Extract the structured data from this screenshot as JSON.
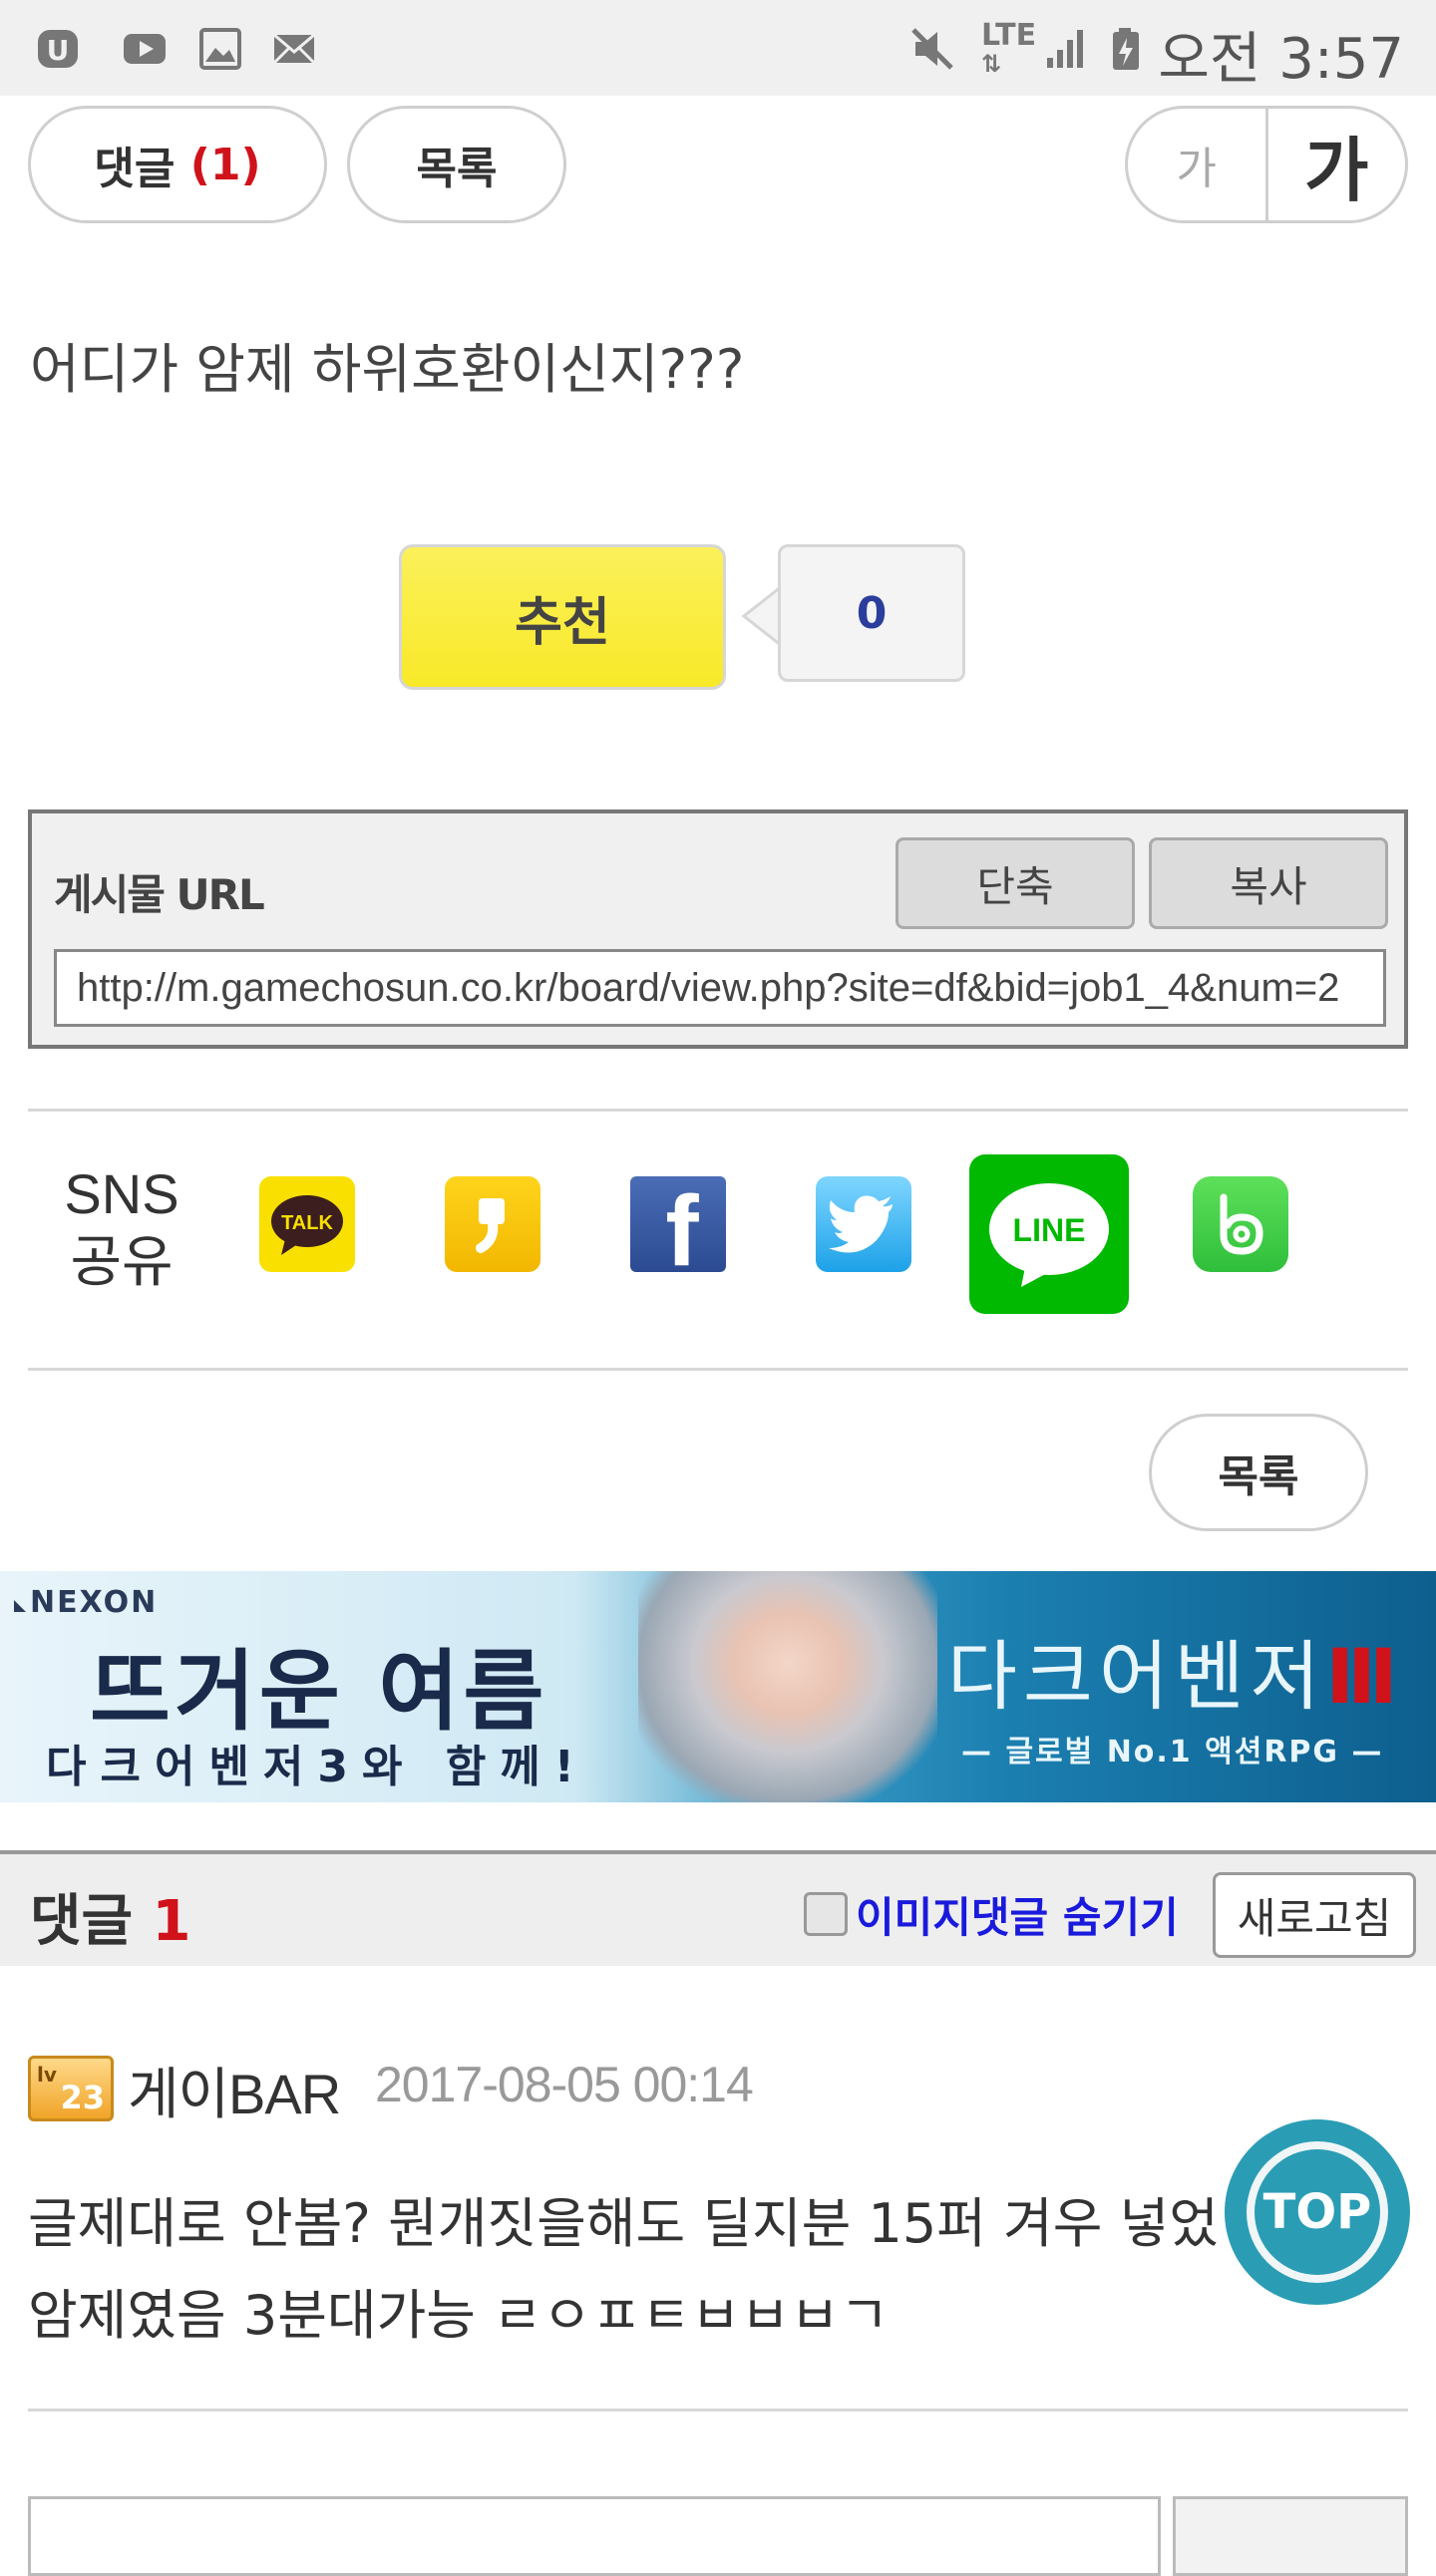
{
  "status_bar": {
    "time": "오전 3:57",
    "network": "LTE",
    "left_icons": [
      "uplus-icon",
      "youtube-icon",
      "gallery-icon",
      "mail-icon"
    ],
    "right_icons": [
      "mute-icon",
      "lte-icon",
      "signal-icon",
      "battery-icon"
    ]
  },
  "top_bar": {
    "comments_label": "댓글",
    "comments_count": "(1)",
    "list_label": "목록",
    "font_small": "가",
    "font_large": "가"
  },
  "post": {
    "body": "어디가 암제 하위호환이신지???"
  },
  "recommend": {
    "label": "추천",
    "count": "0"
  },
  "url_box": {
    "label": "게시물 URL",
    "shorten_label": "단축",
    "copy_label": "복사",
    "url": "http://m.gamechosun.co.kr/board/view.php?site=df&bid=job1_4&num=2"
  },
  "sns": {
    "label_line1": "SNS",
    "label_line2": "공유",
    "icons": [
      "kakaotalk-icon",
      "kakaostory-icon",
      "facebook-icon",
      "twitter-icon",
      "line-icon",
      "band-icon"
    ],
    "talk_text": "TALK",
    "line_text": "LINE",
    "facebook_text": "f"
  },
  "bottom_list_label": "목록",
  "banner": {
    "brand": "NEXON",
    "headline": "뜨거운 여름",
    "subline": "다크어벤저3와 함께!",
    "game_title": "다크어벤저",
    "game_tagline": "— 글로벌 No.1 액션RPG —"
  },
  "comments": {
    "title": "댓글",
    "count": "1",
    "hide_images_label": "이미지댓글 숨기기",
    "refresh_label": "새로고침",
    "items": [
      {
        "level": "23",
        "author": "게이BAR",
        "date": "2017-08-05 00:14",
        "line1": "글제대로 안봄? 뭔개짓을해도 딜지분 15퍼 겨우 넣었",
        "line2": "암제였음 3분대가능 ㄹㅇㅍㅌㅂㅂㅂㄱ"
      }
    ]
  },
  "top_button_label": "TOP",
  "colors": {
    "count_red": "#d0121b",
    "link_blue": "#1a1adc",
    "recommend_yellow": "#f8e928",
    "top_button": "#2a9db5",
    "line_green": "#00b900"
  }
}
